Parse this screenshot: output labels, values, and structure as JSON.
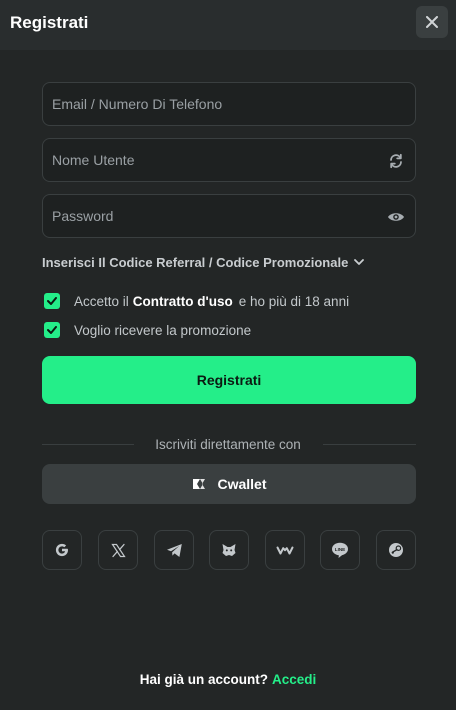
{
  "header": {
    "title": "Registrati"
  },
  "form": {
    "email_placeholder": "Email / Numero Di Telefono",
    "email_value": "",
    "username_placeholder": "Nome Utente",
    "username_value": "",
    "password_placeholder": "Password",
    "password_value": "",
    "referral_label": "Inserisci Il Codice Referral / Codice Promozionale"
  },
  "terms": {
    "prefix": "Accetto il",
    "contract_link": "Contratto d'uso",
    "suffix": "e ho più di 18 anni",
    "checked": true
  },
  "promo": {
    "label": "Voglio ricevere la promozione",
    "checked": true
  },
  "submit_label": "Registrati",
  "divider_text": "Iscriviti direttamente con",
  "cwallet_label": "Cwallet",
  "social_logins": [
    "google-icon",
    "x-icon",
    "telegram-icon",
    "metamask-icon",
    "wallet-connect-icon",
    "line-icon",
    "steam-icon"
  ],
  "footer": {
    "question": "Hai già un account?",
    "login_link": "Accedi"
  },
  "colors": {
    "accent": "#24ee89",
    "background": "#232626",
    "surface": "#3a3f40"
  }
}
